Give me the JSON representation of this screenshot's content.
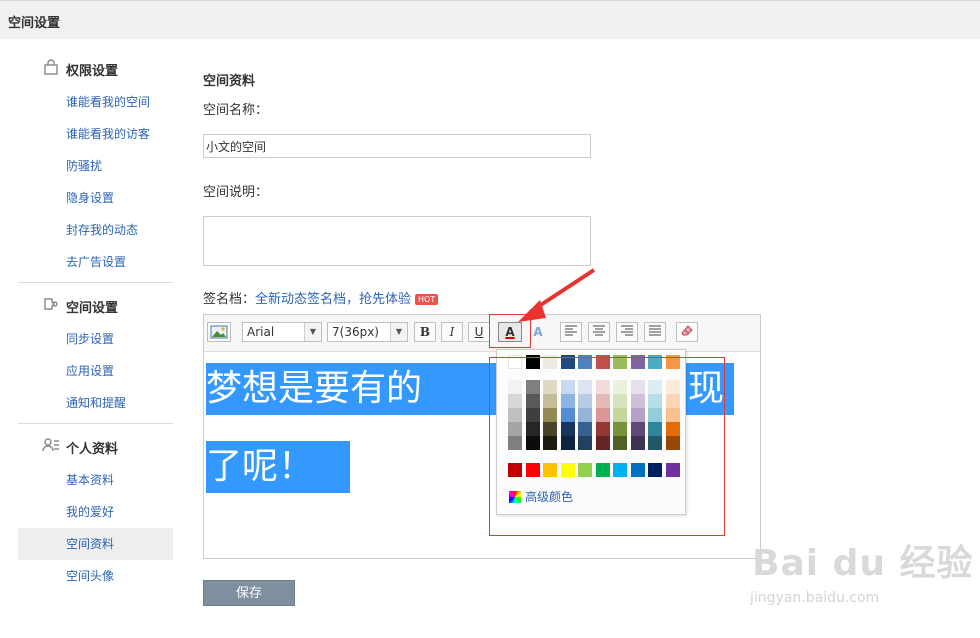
{
  "header": {
    "title": "空间设置"
  },
  "sidebar": {
    "sections": [
      {
        "label": "权限设置",
        "icon": "lock-icon",
        "items": [
          "谁能看我的空间",
          "谁能看我的访客",
          "防骚扰",
          "隐身设置",
          "封存我的动态",
          "去广告设置"
        ]
      },
      {
        "label": "空间设置",
        "icon": "plugin-icon",
        "items": [
          "同步设置",
          "应用设置",
          "通知和提醒"
        ]
      },
      {
        "label": "个人资料",
        "icon": "user-list-icon",
        "items": [
          "基本资料",
          "我的爱好",
          "空间资料",
          "空间头像"
        ]
      }
    ],
    "active_item": "空间资料"
  },
  "form": {
    "section_title": "空间资料",
    "name_label": "空间名称：",
    "name_value": "小文的空间",
    "desc_label": "空间说明：",
    "desc_value": "",
    "sig_label": "签名档：",
    "sig_link": "全新动态签名档，抢先体验",
    "hot_badge": "HOT",
    "save_label": "保存"
  },
  "editor": {
    "font": "Arial",
    "size": "7(36px)",
    "bold": "B",
    "italic": "I",
    "underline": "U",
    "font_color_glyph": "A",
    "bg_color_glyph": "A",
    "content_line1a": "梦想是要有的",
    "content_line1b": "现",
    "content_line2": "了呢！"
  },
  "palette": {
    "top_row": [
      "#ffffff",
      "#000000",
      "#eeece1",
      "#1f497d",
      "#4f81bd",
      "#c0504d",
      "#9bbb59",
      "#8064a2",
      "#4bacc6",
      "#f79646"
    ],
    "shades": [
      [
        "#f2f2f2",
        "#7f7f7f",
        "#ddd9c3",
        "#c6d9f0",
        "#dbe5f1",
        "#f2dcdb",
        "#ebf1dd",
        "#e5e0ec",
        "#dbeef3",
        "#fdeada"
      ],
      [
        "#d8d8d8",
        "#595959",
        "#c4bd97",
        "#8db3e2",
        "#b8cce4",
        "#e5b9b7",
        "#d7e3bc",
        "#ccc1d9",
        "#b7dde8",
        "#fbd5b5"
      ],
      [
        "#bfbfbf",
        "#3f3f3f",
        "#938953",
        "#548dd4",
        "#95b3d7",
        "#d99694",
        "#c3d69b",
        "#b2a2c7",
        "#92cddc",
        "#fac08f"
      ],
      [
        "#a5a5a5",
        "#262626",
        "#494429",
        "#17365d",
        "#366092",
        "#953734",
        "#76923c",
        "#5f497a",
        "#31859b",
        "#e36c09"
      ],
      [
        "#7f7f7f",
        "#0c0c0c",
        "#1d1b10",
        "#0f243e",
        "#244061",
        "#632423",
        "#4f6128",
        "#3f3151",
        "#205867",
        "#974806"
      ]
    ],
    "standard_row": [
      "#c00000",
      "#ff0000",
      "#ffc000",
      "#ffff00",
      "#92d050",
      "#00b050",
      "#00b0f0",
      "#0070c0",
      "#002060",
      "#7030a0"
    ],
    "advanced_label": "高级颜色"
  },
  "watermark": {
    "brand": "Bai du 经验",
    "url": "jingyan.baidu.com"
  }
}
